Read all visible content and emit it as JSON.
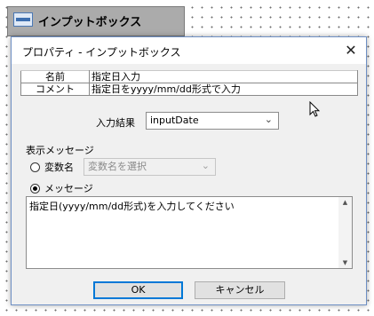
{
  "node": {
    "label": "インプットボックス",
    "icon": "input-box-icon"
  },
  "dialog": {
    "title": "プロパティ - インプットボックス",
    "close": "✕",
    "properties": [
      {
        "key": "名前",
        "value": "指定日入力"
      },
      {
        "key": "コメント",
        "value": "指定日をyyyy/mm/dd形式で入力"
      }
    ],
    "input_result": {
      "label": "入力結果",
      "value": "inputDate"
    },
    "display_message": {
      "label": "表示メッセージ",
      "var_option": {
        "label": "変数名",
        "selected": false,
        "placeholder": "変数名を選択"
      },
      "message_option": {
        "label": "メッセージ",
        "selected": true
      },
      "message_text": "指定日(yyyy/mm/dd形式)を入力してください"
    },
    "buttons": {
      "ok": "OK",
      "cancel": "キャンセル"
    }
  }
}
